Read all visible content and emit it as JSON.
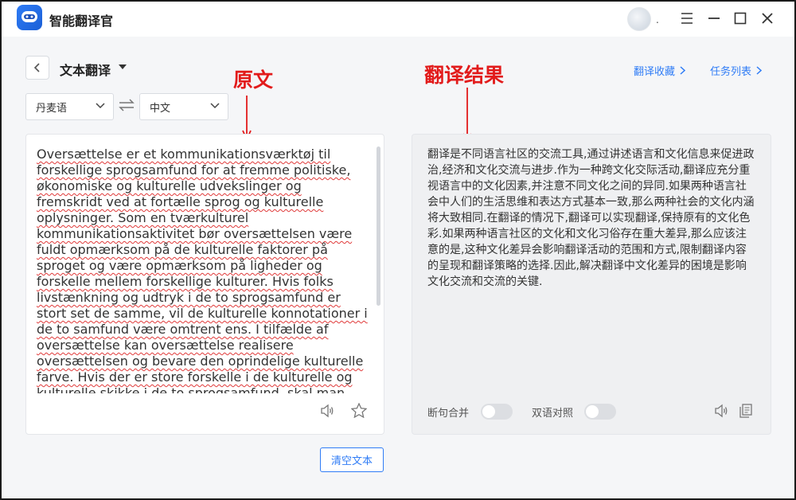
{
  "app": {
    "title": "智能翻译官"
  },
  "window": {
    "avatar_suffix": "."
  },
  "header": {
    "mode_title": "文本翻译",
    "links": {
      "favorites": "翻译收藏",
      "tasks": "任务列表"
    }
  },
  "annotations": {
    "source": "原文",
    "result": "翻译结果"
  },
  "languages": {
    "source": "丹麦语",
    "target": "中文"
  },
  "source_text": "Oversættelse er et kommunikationsværktøj til forskellige sprogsamfund for at fremme politiske, økonomiske og kulturelle udvekslinger og fremskridt ved at fortælle sprog og kulturelle oplysninger. Som en tværkulturel kommunikationsaktivitet bør oversættelsen være fuldt opmærksom på de kulturelle faktorer på sproget og være opmærksom på ligheder og forskelle mellem forskellige kulturer. Hvis folks livstænkning og udtryk i de to sprogsamfund er stort set de samme, vil de kulturelle konnotationer i de to samfund være omtrent ens. I tilfælde af oversættelse kan oversættelse realisere oversættelsen og bevare den oprindelige kulturelle farve. Hvis der er store forskelle i de kulturelle og kulturelle skikke i de to sprogsamfund, skal man",
  "translation_text": "翻译是不同语言社区的交流工具,通过讲述语言和文化信息来促进政治,经济和文化交流与进步.作为一种跨文化交际活动,翻译应充分重视语言中的文化因素,并注意不同文化之间的异同.如果两种语言社会中人们的生活思维和表达方式基本一致,那么两种社会的文化内涵将大致相同.在翻译的情况下,翻译可以实现翻译,保持原有的文化色彩.如果两种语言社区的文化和文化习俗存在重大差异,那么应该注意的是,这种文化差异会影响翻译活动的范围和方式,限制翻译内容的呈现和翻译策略的选择.因此,解决翻译中文化差异的困境是影响文化交流和交流的关键.",
  "options": {
    "sentence_merge": "断句合并",
    "bilingual": "双语对照"
  },
  "actions": {
    "clear": "清空文本"
  },
  "colors": {
    "accent": "#2f7cf6",
    "annotation": "#e21b1b"
  }
}
